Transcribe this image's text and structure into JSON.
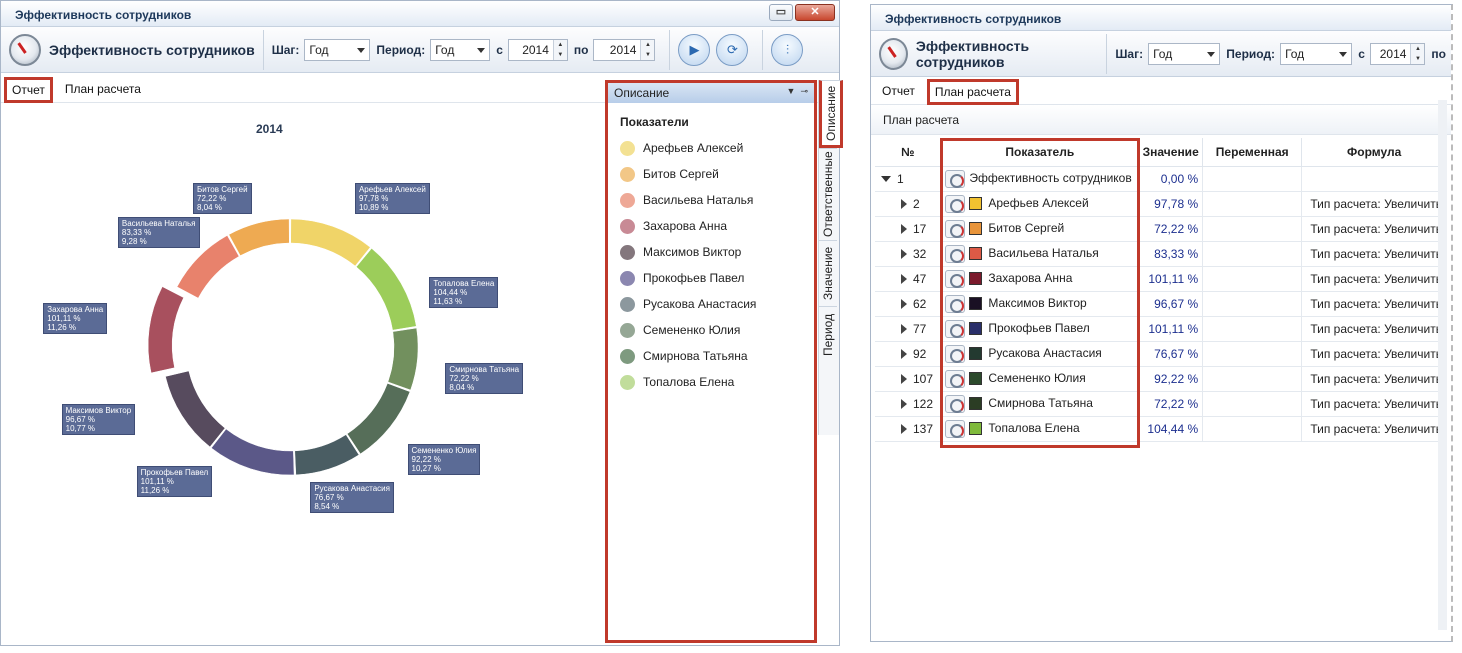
{
  "left": {
    "window_title": "Эффективность сотрудников",
    "window_buttons": [
      "▭",
      "✕"
    ],
    "app_title": "Эффективность сотрудников",
    "step_label": "Шаг:",
    "step_value": "Год",
    "period_label": "Период:",
    "period_value": "Год",
    "from_label": "с",
    "from_value": "2014",
    "to_label": "по",
    "to_value": "2014",
    "tabs": [
      "Отчет",
      "План расчета"
    ],
    "chart_title": "2014",
    "panel_title": "Описание",
    "panel_section": "Показатели",
    "vtabs": [
      "Описание",
      "Ответственные",
      "Значение",
      "Период"
    ]
  },
  "right": {
    "window_title": "Эффективность сотрудников",
    "app_title": "Эффективность сотрудников",
    "step_label": "Шаг:",
    "step_value": "Год",
    "period_label": "Период:",
    "period_value": "Год",
    "from_label": "с",
    "from_value": "2014",
    "to_label": "по",
    "tabs": [
      "Отчет",
      "План расчета"
    ],
    "section_title": "План расчета",
    "columns": [
      "№",
      "Показатель",
      "Значение",
      "Переменная",
      "Формула"
    ],
    "rows": [
      {
        "num": "1",
        "name": "Эффективность сотрудников",
        "value": "0,00 %",
        "formula": ""
      },
      {
        "num": "2",
        "name": "Арефьев Алексей",
        "value": "97,78 %",
        "formula": "Тип расчета: Увеличить"
      },
      {
        "num": "17",
        "name": "Битов Сергей",
        "value": "72,22 %",
        "formula": "Тип расчета: Увеличить"
      },
      {
        "num": "32",
        "name": "Васильева Наталья",
        "value": "83,33 %",
        "formula": "Тип расчета: Увеличить"
      },
      {
        "num": "47",
        "name": "Захарова Анна",
        "value": "101,11 %",
        "formula": "Тип расчета: Увеличить"
      },
      {
        "num": "62",
        "name": "Максимов Виктор",
        "value": "96,67 %",
        "formula": "Тип расчета: Увеличить"
      },
      {
        "num": "77",
        "name": "Прокофьев Павел",
        "value": "101,11 %",
        "formula": "Тип расчета: Увеличить"
      },
      {
        "num": "92",
        "name": "Русакова Анастасия",
        "value": "76,67 %",
        "formula": "Тип расчета: Увеличить"
      },
      {
        "num": "107",
        "name": "Семененко Юлия",
        "value": "92,22 %",
        "formula": "Тип расчета: Увеличить"
      },
      {
        "num": "122",
        "name": "Смирнова Татьяна",
        "value": "72,22 %",
        "formula": "Тип расчета: Увеличить"
      },
      {
        "num": "137",
        "name": "Топалова Елена",
        "value": "104,44 %",
        "formula": "Тип расчета: Увеличить"
      }
    ],
    "swatch_colors": [
      "#f2c230",
      "#e8943a",
      "#dd5a46",
      "#7b1a2c",
      "#1a1024",
      "#2a2f6a",
      "#233a30",
      "#2c4a2c",
      "#2b3d24",
      "#7fba3b"
    ]
  },
  "chart_data": {
    "type": "pie",
    "variant": "doughnut",
    "title": "2014",
    "legend_placement": "right",
    "series": [
      {
        "name": "Арефьев Алексей",
        "value_label": "97,78 %",
        "share": 10.89,
        "share_label": "10,89 %",
        "color": "#f0d468"
      },
      {
        "name": "Топалова Елена",
        "value_label": "104,44 %",
        "share": 11.63,
        "share_label": "11,63 %",
        "color": "#9ccd5a"
      },
      {
        "name": "Смирнова Татьяна",
        "value_label": "72,22 %",
        "share": 8.04,
        "share_label": "8,04 %",
        "color": "#72905e"
      },
      {
        "name": "Семененко Юлия",
        "value_label": "92,22 %",
        "share": 10.27,
        "share_label": "10,27 %",
        "color": "#566e59"
      },
      {
        "name": "Русакова Анастасия",
        "value_label": "76,67 %",
        "share": 8.54,
        "share_label": "8,54 %",
        "color": "#4a5d63"
      },
      {
        "name": "Прокофьев Павел",
        "value_label": "101,11 %",
        "share": 11.26,
        "share_label": "11,26 %",
        "color": "#5b5888"
      },
      {
        "name": "Максимов Виктор",
        "value_label": "96,67 %",
        "share": 10.77,
        "share_label": "10,77 %",
        "color": "#574b5e"
      },
      {
        "name": "Захарова Анна",
        "value_label": "101,11 %",
        "share": 11.26,
        "share_label": "11,26 %",
        "color": "#a8505e",
        "exploded": true
      },
      {
        "name": "Васильева Наталья",
        "value_label": "83,33 %",
        "share": 9.28,
        "share_label": "9,28 %",
        "color": "#e8826c"
      },
      {
        "name": "Битов Сергей",
        "value_label": "72,22 %",
        "share": 8.04,
        "share_label": "8,04 %",
        "color": "#eeaa52"
      }
    ],
    "legend_order": [
      "Арефьев Алексей",
      "Битов Сергей",
      "Васильева Наталья",
      "Захарова Анна",
      "Максимов Виктор",
      "Прокофьев Павел",
      "Русакова Анастасия",
      "Семененко Юлия",
      "Смирнова Татьяна",
      "Топалова Елена"
    ],
    "legend_colors": [
      "#f3e193",
      "#f2c787",
      "#eea896",
      "#c88a95",
      "#84777d",
      "#8b87b0",
      "#8c989e",
      "#95a795",
      "#7e9a7f",
      "#c1dd9b"
    ]
  }
}
